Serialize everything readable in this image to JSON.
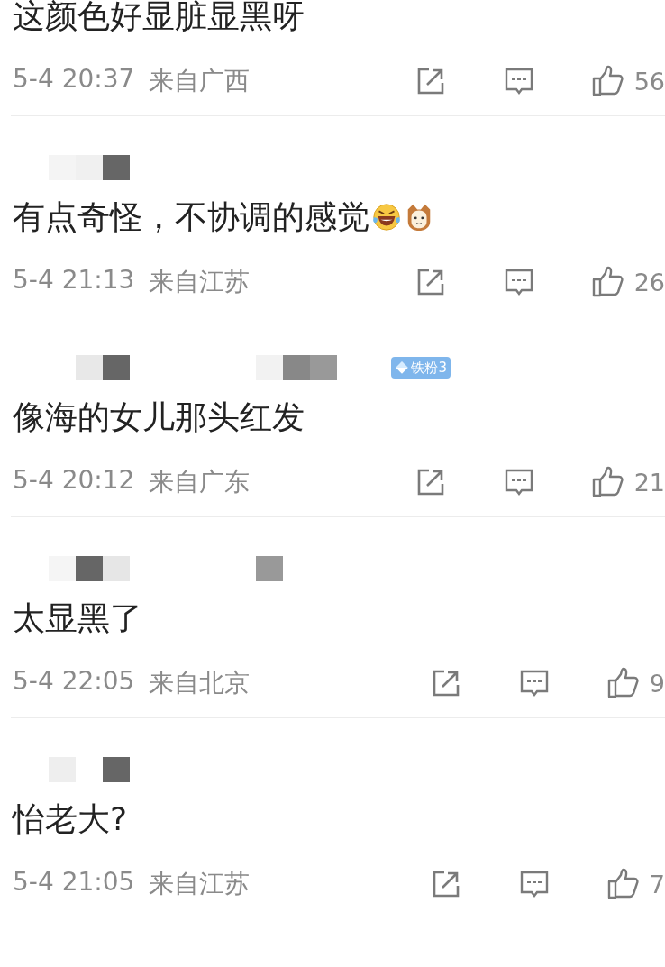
{
  "comments": [
    {
      "text": "这颜色好显脏显黑呀",
      "time": "5-4 20:37",
      "location": "来自广西",
      "likes": "56",
      "divider_below": true
    },
    {
      "author": {
        "kind": "pixelated"
      },
      "text": "有点奇怪，不协调的感觉",
      "emoji": [
        {
          "kind": "laughing-tears"
        },
        {
          "kind": "cat"
        }
      ],
      "time": "5-4 21:13",
      "location": "来自江苏",
      "likes": "26",
      "divider_below": false
    },
    {
      "author": {
        "kind": "pixelated"
      },
      "badge": "铁粉3",
      "text": "像海的女儿那头红发",
      "time": "5-4 20:12",
      "location": "来自广东",
      "likes": "21",
      "divider_below": true
    },
    {
      "author": {
        "kind": "pixelated"
      },
      "text": "太显黑了",
      "time": "5-4 22:05",
      "location": "来自北京",
      "likes": "9",
      "divider_below": true
    },
    {
      "author": {
        "kind": "pixelated"
      },
      "text": "怡老大?",
      "time": "5-4 21:05",
      "location": "来自江苏",
      "likes": "7",
      "divider_below": false
    }
  ]
}
